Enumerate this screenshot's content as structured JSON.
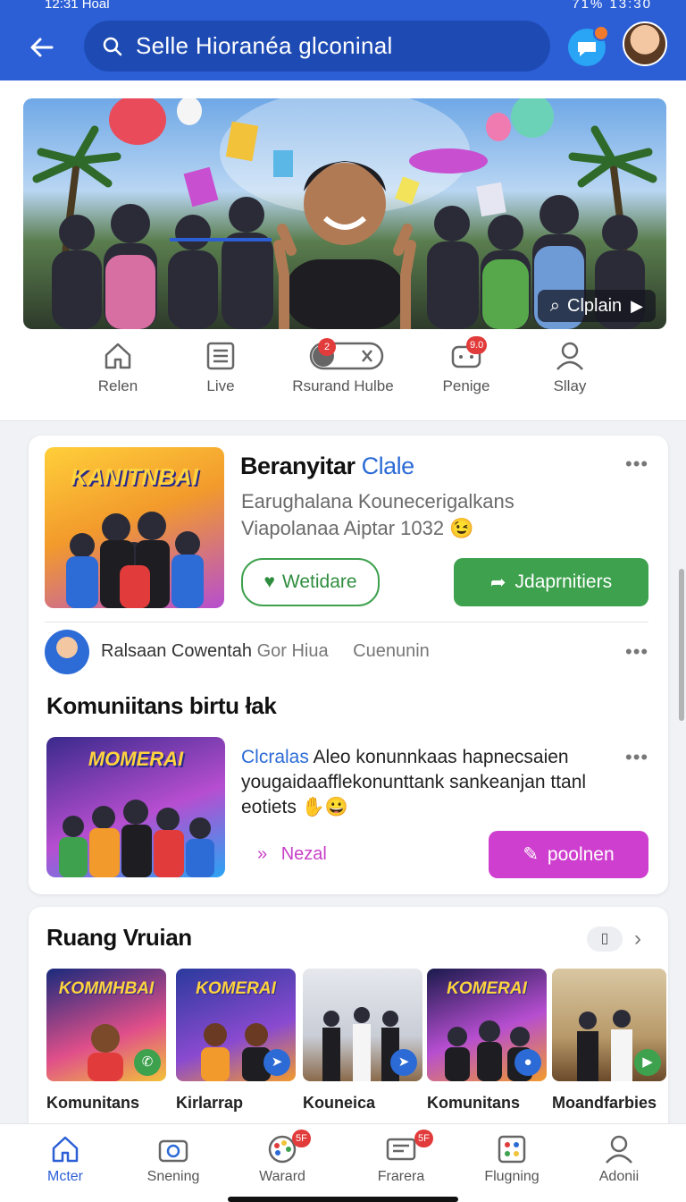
{
  "status": {
    "time": "12:31 Hoal",
    "right": "71% 13:30"
  },
  "search": {
    "text": "Selle Hioranéa glconinal"
  },
  "hero": {
    "button_label": "Clplain"
  },
  "tabs": [
    {
      "label": "Relen",
      "icon": "home-icon"
    },
    {
      "label": "Live",
      "icon": "list-icon"
    },
    {
      "label": "Rsurand Hulbe",
      "icon": "toggle-icon",
      "badge": "2"
    },
    {
      "label": "Penige",
      "icon": "game-controller-icon",
      "badge": "9.0"
    },
    {
      "label": "Sllay",
      "icon": "person-icon"
    }
  ],
  "card1": {
    "thumb_title": "KANITNBAI",
    "title": "Beranyitar",
    "title_accent": "Clale",
    "subtitle": "Earughalana Kounecerigalkans Viapolanaa Aiptar 1032 😉",
    "btn_outline": "Wetidare",
    "btn_green": "Jdaprnitiers"
  },
  "card2": {
    "meta_name": "Ralsaan Cowentah",
    "meta_group": "Gor Hiua",
    "meta_extra": "Cuenunin",
    "section_title": "Komuniitans birtu łak",
    "thumb_title": "MOMERAI",
    "body_accent": "Clcralas",
    "body": " Aleo konunnkaas hapnecsaien yougaidaafflekonunttank sankeanjan ttanl eotiets ✋😀",
    "link": "Nezal",
    "btn_pink": "poolnen"
  },
  "rail": {
    "title": "Ruang Vruian",
    "items": [
      {
        "caption": "Komunitans",
        "thumb": "KOMMHBAI",
        "icon": "chat-icon",
        "color": "#3ea14e"
      },
      {
        "caption": "Kirlarrap",
        "thumb": "KOMERAI",
        "icon": "share-icon",
        "color": "#2c6bd6"
      },
      {
        "caption": "Kouneica",
        "thumb": "",
        "icon": "share-icon",
        "color": "#2c6bd6"
      },
      {
        "caption": "Komunitans",
        "thumb": "KOMERAI",
        "icon": "person-icon",
        "color": "#2c6bd6"
      },
      {
        "caption": "Moandfarbies",
        "thumb": "",
        "icon": "play-icon",
        "color": "#3ea14e"
      }
    ]
  },
  "bottom_nav": [
    {
      "label": "Mcter",
      "icon": "home-icon",
      "active": true
    },
    {
      "label": "Snening",
      "icon": "camera-icon"
    },
    {
      "label": "Warard",
      "icon": "palette-icon",
      "badge": "5F"
    },
    {
      "label": "Frarera",
      "icon": "message-icon",
      "badge": "5F"
    },
    {
      "label": "Flugning",
      "icon": "puzzle-icon"
    },
    {
      "label": "Adonii",
      "icon": "person-icon"
    }
  ],
  "colors": {
    "primary": "#2c5fd6",
    "green": "#3ea14e",
    "pink": "#cf3fcf",
    "accent_blue": "#2c6bd6"
  }
}
